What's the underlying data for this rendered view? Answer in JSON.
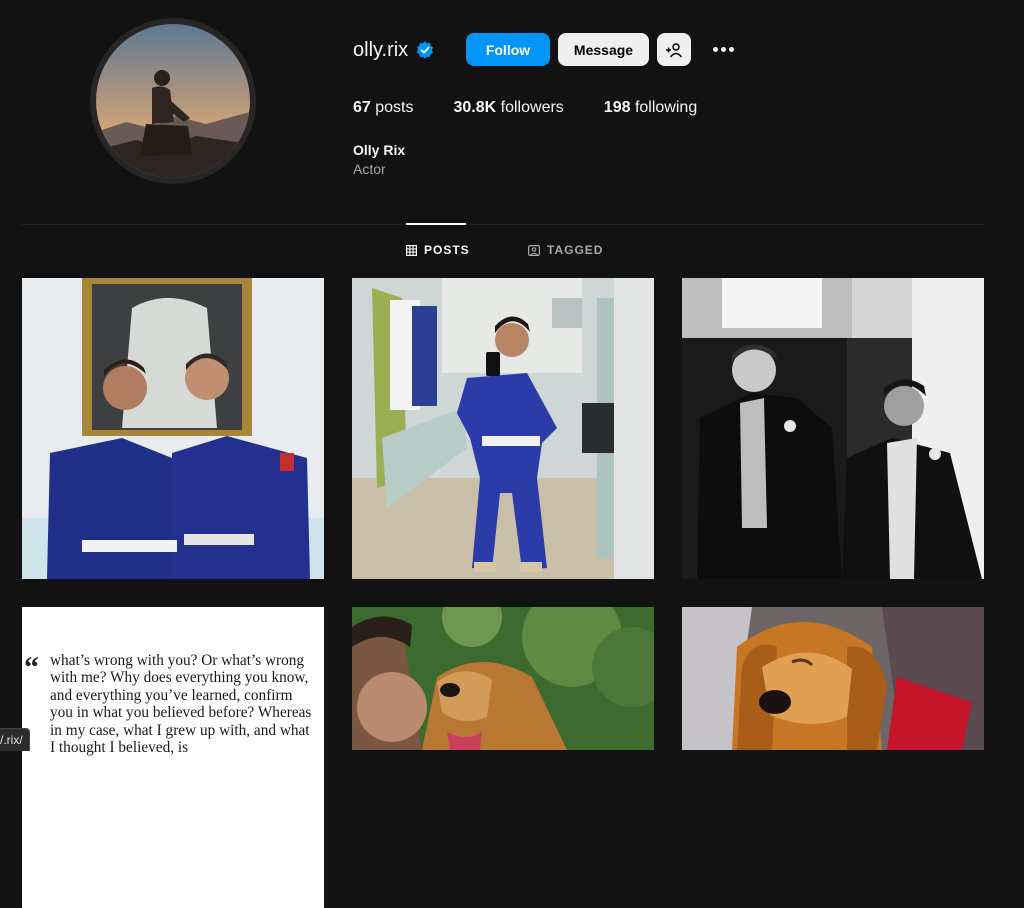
{
  "profile": {
    "username": "olly.rix",
    "verified": true,
    "full_name": "Olly Rix",
    "category": "Actor",
    "stats": {
      "posts_count": "67",
      "posts_label": "posts",
      "followers_count": "30.8K",
      "followers_label": "followers",
      "following_count": "198",
      "following_label": "following"
    }
  },
  "actions": {
    "follow_label": "Follow",
    "message_label": "Message",
    "suggest_icon": "add-person-icon",
    "more_icon": "more-options-icon"
  },
  "tabs": [
    {
      "label": "POSTS",
      "icon": "grid-icon",
      "active": true
    },
    {
      "label": "TAGGED",
      "icon": "tagged-icon",
      "active": false
    }
  ],
  "posts": {
    "quote_mark": "“",
    "quote_text": "what’s wrong with you? Or what’s wrong with me? Why does everything you know, and everything you’ve learned, confirm you in what you believed before? Whereas in my case, what I grew up with, and what I thought I believed, is"
  },
  "status_bar": {
    "link_text": "/.rix/"
  },
  "colors": {
    "background": "#121212",
    "accent": "#0095f6",
    "verified": "#0095f6",
    "secondary_text": "#a8a8a8"
  }
}
